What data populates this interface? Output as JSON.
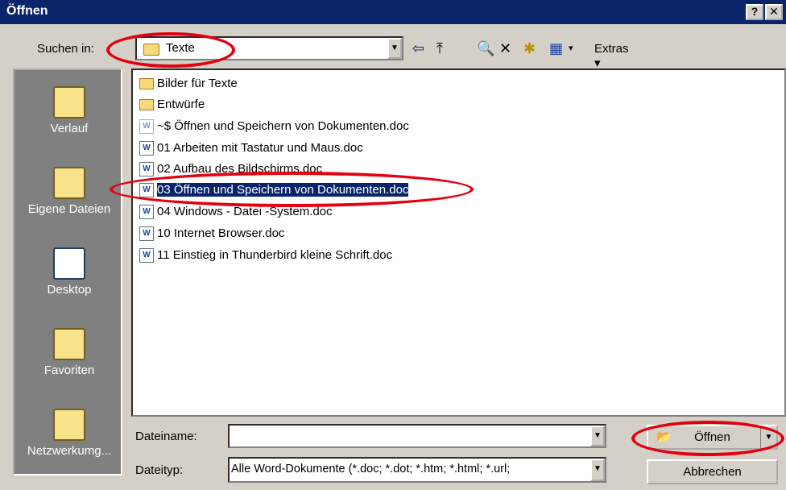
{
  "window": {
    "title": "Öffnen",
    "help_label": "?",
    "close_label": "✕"
  },
  "lookin": {
    "label": "Suchen in:",
    "value": "Texte"
  },
  "toolbar": {
    "extras_label": "Extras ▾",
    "icons": [
      "back-icon",
      "up-folder-icon",
      "search-web-icon",
      "delete-icon",
      "new-folder-icon",
      "views-icon"
    ]
  },
  "places": [
    {
      "label": "Verlauf",
      "icon": "history-icon"
    },
    {
      "label": "Eigene Dateien",
      "icon": "my-documents-icon"
    },
    {
      "label": "Desktop",
      "icon": "desktop-icon"
    },
    {
      "label": "Favoriten",
      "icon": "favorites-icon"
    },
    {
      "label": "Netzwerkumg...",
      "icon": "network-icon"
    }
  ],
  "files": [
    {
      "name": "Bilder für Texte",
      "type": "folder"
    },
    {
      "name": "Entwürfe",
      "type": "folder"
    },
    {
      "name": "~$ Öffnen und Speichern von Dokumenten.doc",
      "type": "doc-temp"
    },
    {
      "name": "01 Arbeiten mit Tastatur und Maus.doc",
      "type": "doc"
    },
    {
      "name": "02 Aufbau des Bildschirms.doc",
      "type": "doc"
    },
    {
      "name": "03 Öffnen und Speichern von Dokumenten.doc",
      "type": "doc",
      "selected": true
    },
    {
      "name": "04 Windows - Datei -System.doc",
      "type": "doc"
    },
    {
      "name": "10 Internet Browser.doc",
      "type": "doc"
    },
    {
      "name": "11 Einstieg in Thunderbird kleine Schrift.doc",
      "type": "doc"
    }
  ],
  "filename": {
    "label": "Dateiname:",
    "value": ""
  },
  "filetype": {
    "label": "Dateityp:",
    "value": "Alle Word-Dokumente (*.doc; *.dot; *.htm; *.html; *.url;"
  },
  "buttons": {
    "open_label": "Öffnen",
    "cancel_label": "Abbrechen"
  },
  "colors": {
    "titlebar": "#0a246a",
    "selection": "#0a246a",
    "annotation": "#e4000f"
  }
}
